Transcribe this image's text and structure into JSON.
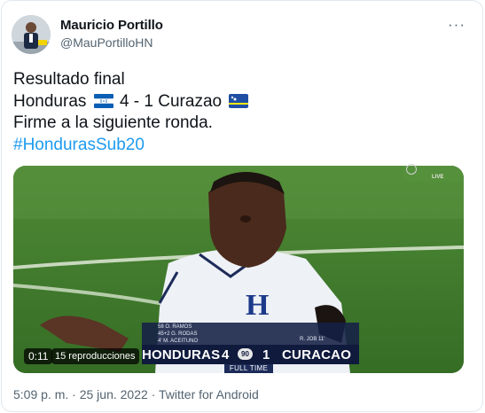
{
  "author": {
    "name": "Mauricio Portillo",
    "handle": "@MauPortilloHN"
  },
  "menu_icon": "more-dots-icon",
  "tweet": {
    "line1": "Resultado final",
    "home_team": "Honduras",
    "score": "4 - 1",
    "away_team": "Curazao",
    "line3": "Firme a la siguiente ronda.",
    "hashtag": "#HondurasSub20"
  },
  "video": {
    "time": "0:11",
    "views": "15 reproducciones",
    "live_label": "LIVE",
    "scoreboard": {
      "home": "HONDURAS",
      "home_score": "4",
      "clock": "90",
      "away_score": "1",
      "away": "CURACAO",
      "status": "FULL TIME",
      "home_scorers": [
        "58  O. RAMOS",
        "45+2  G. RODAS",
        "4'  M. ACEITUNO"
      ],
      "away_scorers": "R. JOB  11'"
    }
  },
  "meta": {
    "time": "5:09 p. m.",
    "date": "25 jun. 2022",
    "source": "Twitter for Android",
    "separator": "·"
  },
  "colors": {
    "link": "#1d9bf0",
    "secondary": "#536471",
    "scoreboard": "#101a3d"
  }
}
